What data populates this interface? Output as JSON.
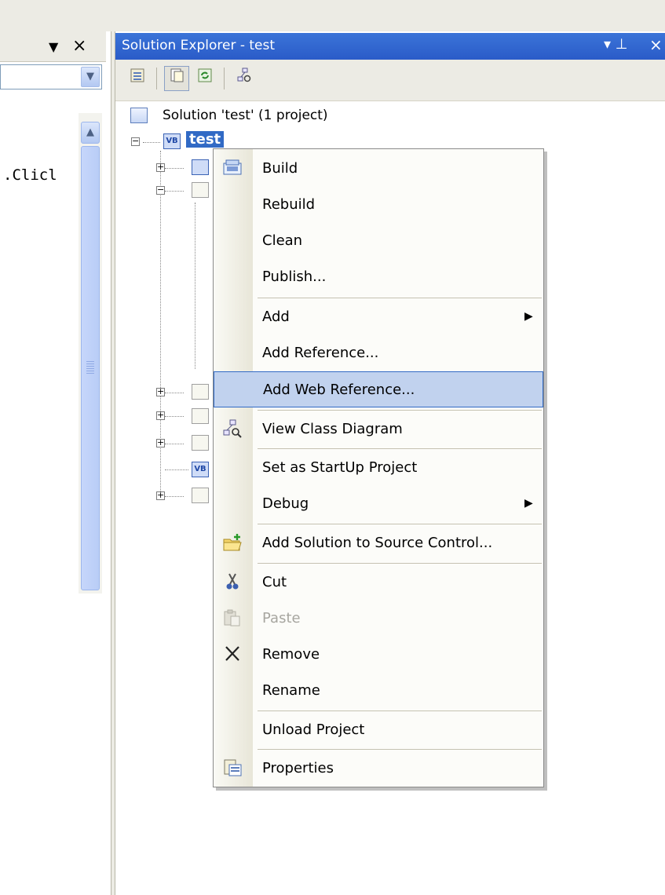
{
  "left_pane": {
    "code_text": ".Clicl"
  },
  "solution_explorer": {
    "title": "Solution Explorer - test",
    "pin_glyph": "↓ 1",
    "close_glyph": "×",
    "solution_label": "Solution 'test' (1 project)",
    "project_label": "test"
  },
  "context_menu": {
    "items": [
      {
        "label": "Build",
        "icon": "build-icon"
      },
      {
        "label": "Rebuild"
      },
      {
        "label": "Clean"
      },
      {
        "label": "Publish..."
      },
      {
        "label": "Add",
        "submenu": true
      },
      {
        "label": "Add Reference..."
      },
      {
        "label": "Add Web Reference...",
        "highlighted": true
      },
      {
        "label": "View Class Diagram",
        "icon": "class-diagram-icon"
      },
      {
        "label": "Set as StartUp Project"
      },
      {
        "label": "Debug",
        "submenu": true
      },
      {
        "label": "Add Solution to Source Control...",
        "icon": "add-folder-icon"
      },
      {
        "label": "Cut",
        "icon": "scissors-icon"
      },
      {
        "label": "Paste",
        "icon": "paste-icon",
        "disabled": true
      },
      {
        "label": "Remove",
        "icon": "remove-x-icon"
      },
      {
        "label": "Rename"
      },
      {
        "label": "Unload Project"
      },
      {
        "label": "Properties",
        "icon": "properties-icon"
      }
    ]
  },
  "colors": {
    "titlebar": "#2a5bc8",
    "selection": "#316ac5",
    "menu_highlight": "#c1d2ee",
    "chrome": "#ecebe4"
  }
}
